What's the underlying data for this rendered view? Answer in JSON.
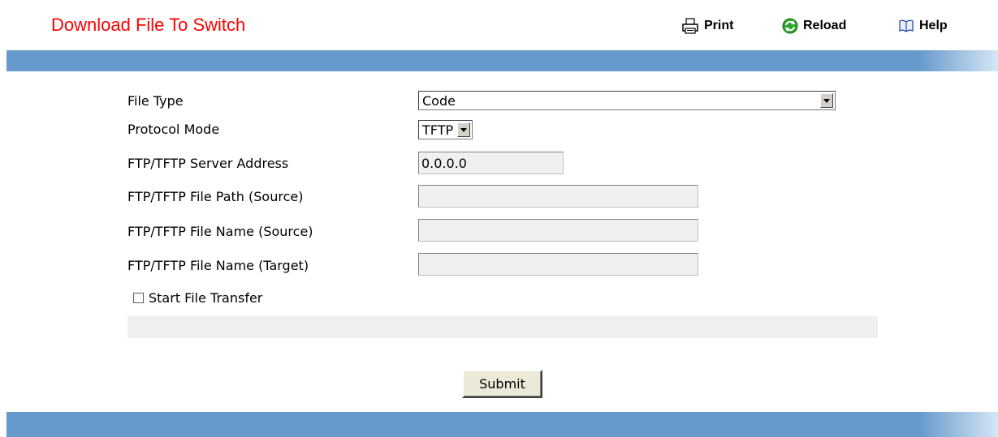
{
  "header": {
    "title": "Download File To Switch",
    "print_label": "Print",
    "reload_label": "Reload",
    "help_label": "Help"
  },
  "form": {
    "file_type": {
      "label": "File Type",
      "value": "Code"
    },
    "protocol_mode": {
      "label": "Protocol Mode",
      "value": "TFTP"
    },
    "server_address": {
      "label": "FTP/TFTP Server Address",
      "value": "0.0.0.0"
    },
    "file_path_source": {
      "label": "FTP/TFTP File Path (Source)",
      "value": ""
    },
    "file_name_source": {
      "label": "FTP/TFTP File Name (Source)",
      "value": ""
    },
    "file_name_target": {
      "label": "FTP/TFTP File Name (Target)",
      "value": ""
    },
    "start_transfer": {
      "label": "Start File Transfer",
      "checked": false
    },
    "status_message": ""
  },
  "actions": {
    "submit_label": "Submit"
  },
  "colors": {
    "title": "#ff0000",
    "band": "#6699cc"
  },
  "icons": {
    "print": "printer-icon",
    "reload": "reload-icon",
    "help": "help-book-icon"
  }
}
